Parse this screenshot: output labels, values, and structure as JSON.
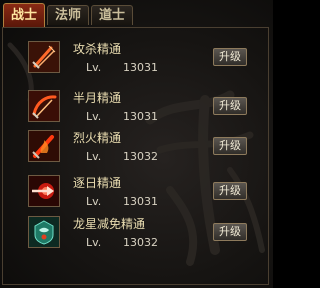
{
  "tabs": [
    {
      "label": "战士",
      "active": true
    },
    {
      "label": "法师",
      "active": false
    },
    {
      "label": "道士",
      "active": false
    }
  ],
  "skills": [
    {
      "name": "攻杀精通",
      "lv_label": "Lv.",
      "level": "13031",
      "button": "升级",
      "icon": "sword-slash-icon"
    },
    {
      "name": "半月精通",
      "lv_label": "Lv.",
      "level": "13031",
      "button": "升级",
      "icon": "crescent-sword-icon"
    },
    {
      "name": "烈火精通",
      "lv_label": "Lv.",
      "level": "13032",
      "button": "升级",
      "icon": "flame-sword-icon"
    },
    {
      "name": "逐日精通",
      "lv_label": "Lv.",
      "level": "13031",
      "button": "升级",
      "icon": "sun-chase-icon"
    },
    {
      "name": "龙星减免精通",
      "lv_label": "Lv.",
      "level": "13032",
      "button": "升级",
      "icon": "dragon-star-icon"
    }
  ],
  "colors": {
    "active_tab": "#7a2410",
    "text": "#e9dcb0",
    "border": "#6d5a42"
  }
}
